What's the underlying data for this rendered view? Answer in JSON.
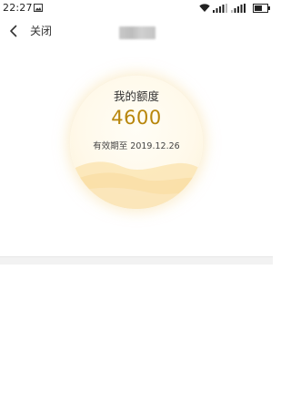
{
  "status_bar": {
    "time": "22:27",
    "icons": [
      "gallery-icon",
      "wifi-icon",
      "signal-icon",
      "signal-icon",
      "battery-icon"
    ]
  },
  "nav": {
    "back_icon": "chevron-left-icon",
    "close_label": "关闭"
  },
  "quota": {
    "title": "我的额度",
    "amount": "4600",
    "expiry": "有效期至 2019.12.26"
  },
  "colors": {
    "amount": "#b8860b",
    "card_background": "#fff9ea",
    "card_glow": "#f8e2af",
    "divider": "#f2f2f2"
  }
}
